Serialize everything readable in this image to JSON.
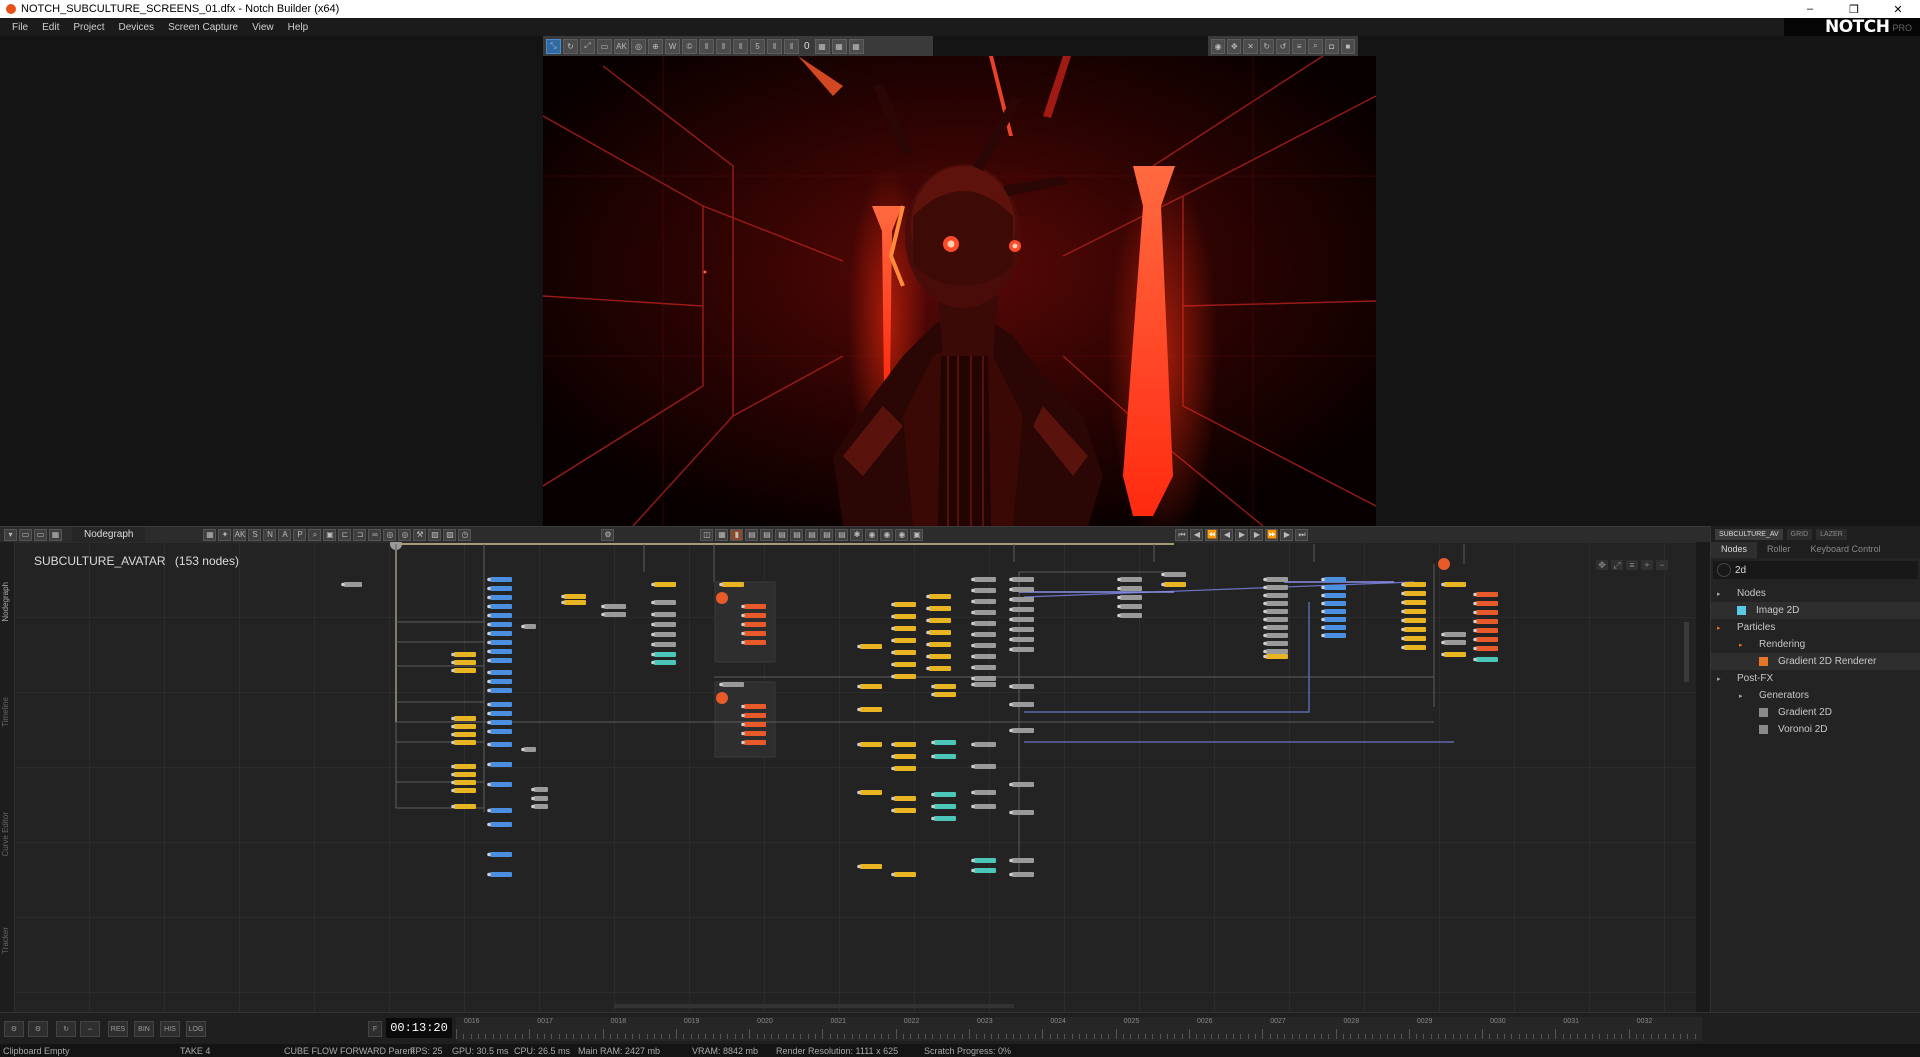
{
  "window": {
    "title": "NOTCH_SUBCULTURE_SCREENS_01.dfx - Notch Builder (x64)",
    "minimize": "–",
    "maximize": "❐",
    "close": "✕"
  },
  "menu": [
    "File",
    "Edit",
    "Project",
    "Devices",
    "Screen Capture",
    "View",
    "Help"
  ],
  "brand": {
    "logo": "NOTCH",
    "tier": "PRO"
  },
  "viewport_toolbar": {
    "frame_value": "0"
  },
  "nodegraph": {
    "tab_label": "Nodegraph",
    "toolbar_letters": [
      "AK",
      "S",
      "N",
      "A",
      "P"
    ],
    "layer_name": "SUBCULTURE_AVATAR",
    "node_count": "(153  nodes)",
    "side_tabs": [
      "Nodegraph",
      "Timeline",
      "Curve Editor",
      "Tracker"
    ]
  },
  "right_panel": {
    "top_tabs": [
      "SUBCULTURE_AV",
      "GRID",
      "LAZER"
    ],
    "tabs": [
      "Nodes",
      "Roller",
      "Keyboard Control"
    ],
    "search_value": "2d",
    "tree": [
      {
        "label": "Nodes",
        "level": 0,
        "arrow": "▸",
        "color": ""
      },
      {
        "label": "Image 2D",
        "level": 1,
        "arrow": "",
        "color": "#5bc8e6"
      },
      {
        "label": "Particles",
        "level": 0,
        "arrow": "▸",
        "color": ""
      },
      {
        "label": "Rendering",
        "level": 1,
        "arrow": "▸",
        "color": ""
      },
      {
        "label": "Gradient 2D Renderer",
        "level": 2,
        "arrow": "",
        "color": "#e8742a"
      },
      {
        "label": "Post-FX",
        "level": 0,
        "arrow": "▸",
        "color": ""
      },
      {
        "label": "Generators",
        "level": 1,
        "arrow": "▸",
        "color": ""
      },
      {
        "label": "Gradient 2D",
        "level": 2,
        "arrow": "",
        "color": "#8a8a8a"
      },
      {
        "label": "Voronoi 2D",
        "level": 2,
        "arrow": "",
        "color": "#8a8a8a"
      }
    ]
  },
  "timeline": {
    "buttons": [
      "RES",
      "BIN",
      "HIS",
      "LOG"
    ],
    "timecode": "00:13:20",
    "ticks": [
      "0016",
      "0017",
      "0018",
      "0019",
      "0020",
      "0021",
      "0022",
      "0023",
      "0024",
      "0025",
      "0026",
      "0027",
      "0028",
      "0029",
      "0030",
      "0031",
      "0032"
    ]
  },
  "status": {
    "clipboard": "Clipboard Empty",
    "take": "TAKE 4",
    "parent": "CUBE FLOW FORWARD  Parent",
    "fps": "FPS: 25",
    "gpu": "GPU: 30.5 ms",
    "cpu": "CPU: 26.5 ms",
    "ram": "Main RAM: 2427 mb",
    "vram": "VRAM: 8842 mb",
    "resolution": "Render Resolution: 1111 x 625",
    "scratch": "Scratch Progress: 0%"
  },
  "colors": {
    "node_blue": "#4a8fe0",
    "node_yellow": "#e8b422",
    "node_orange": "#e85a2a",
    "node_teal": "#4cc6b8",
    "node_grey": "#9a9a9a",
    "accent": "#2f6aa3"
  }
}
